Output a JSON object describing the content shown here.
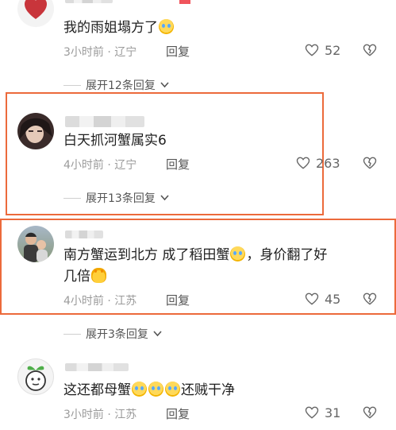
{
  "comments": [
    {
      "text": "我的雨姐塌方了",
      "emoji": "crying-face",
      "time": "3小时前",
      "location": "辽宁",
      "reply_label": "回复",
      "likes": "52",
      "expand_label": "展开12条回复"
    },
    {
      "text": "白天抓河蟹属实6",
      "time": "4小时前",
      "location": "辽宁",
      "reply_label": "回复",
      "likes": "263",
      "expand_label": "展开13条回复"
    },
    {
      "text_part1": "南方蟹运到北方  成了稻田蟹",
      "text_part2": "，身价翻了好",
      "text_part3": "几倍",
      "emoji": "laughing-crying-face",
      "emoji2": "clapping-hands",
      "time": "4小时前",
      "location": "江苏",
      "reply_label": "回复",
      "likes": "45",
      "expand_label": "展开3条回复"
    },
    {
      "text_part1": "这还都母蟹",
      "text_part2": "还贼干净",
      "emoji": "laughing-crying-face",
      "time": "3小时前",
      "location": "江苏",
      "reply_label": "回复",
      "likes": "31"
    }
  ],
  "separator": " · ",
  "colors": {
    "highlight": "#ec6a3b",
    "meta": "#9b9b9b",
    "heart": "#c8353b"
  }
}
